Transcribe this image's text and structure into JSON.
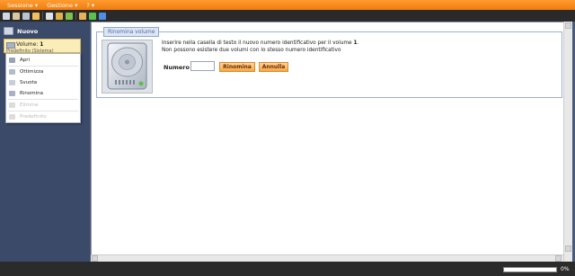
{
  "menu": [
    "Sessione ▾",
    "Gestione ▾",
    "? ▾"
  ],
  "toolbar": {
    "buttons": [
      {
        "icon": "network-icon",
        "color": "#cfd6e4"
      },
      {
        "icon": "users-icon",
        "color": "#d7c9a0"
      },
      {
        "icon": "drive-icon",
        "color": "#b9c3d2"
      },
      {
        "icon": "folder-icon",
        "color": "#f2c15a"
      },
      {
        "icon": "document-icon",
        "color": "#dfe4ec"
      },
      {
        "icon": "flag-icon",
        "color": "#e0b34a"
      },
      {
        "icon": "puzzle-icon",
        "color": "#7cc24f"
      },
      {
        "icon": "box-icon",
        "color": "#e7b35a"
      },
      {
        "icon": "refresh-icon",
        "color": "#5bbf4f"
      },
      {
        "icon": "info-icon",
        "color": "#4f8ee0"
      }
    ]
  },
  "sidebar": {
    "header": "Nuovo",
    "volume": {
      "label": "Volume: ",
      "number": "1",
      "subtitle": "Predefinito (Sistema)"
    }
  },
  "context_menu": [
    {
      "label": "Apri",
      "icon": "open-icon",
      "color": "#9aa3b5",
      "disabled": false
    },
    {
      "label": "Ottimizza",
      "icon": "optimize-icon",
      "color": "#b3bccb",
      "disabled": false
    },
    {
      "label": "Svuota",
      "icon": "empty-icon",
      "color": "#c7ced9",
      "disabled": false
    },
    {
      "label": "Rinomina",
      "icon": "rename-icon",
      "color": "#a9b2c2",
      "disabled": false
    },
    {
      "label": "Elimina",
      "icon": "delete-icon",
      "color": "#dcdcdc",
      "disabled": true
    },
    {
      "label": "Predefinito",
      "icon": "default-icon",
      "color": "#dcdcdc",
      "disabled": true
    }
  ],
  "dialog": {
    "legend": "Rinomina volume",
    "instruction_prefix": "Inserire nella casella di testo il nuovo numero identificativo per il volume ",
    "instruction_volume": "1",
    "instruction_suffix": ".",
    "instruction_line2": "Non possono esistere due volumi con lo stesso numero identificativo",
    "number_label": "Numero",
    "number_value": "",
    "rename_button": "Rinomina",
    "cancel_button": "Annulla"
  },
  "status": {
    "progress_percent": 0,
    "progress_text": "0%"
  },
  "colors": {
    "accent": "#f08a20",
    "background": "#4a5a78"
  }
}
